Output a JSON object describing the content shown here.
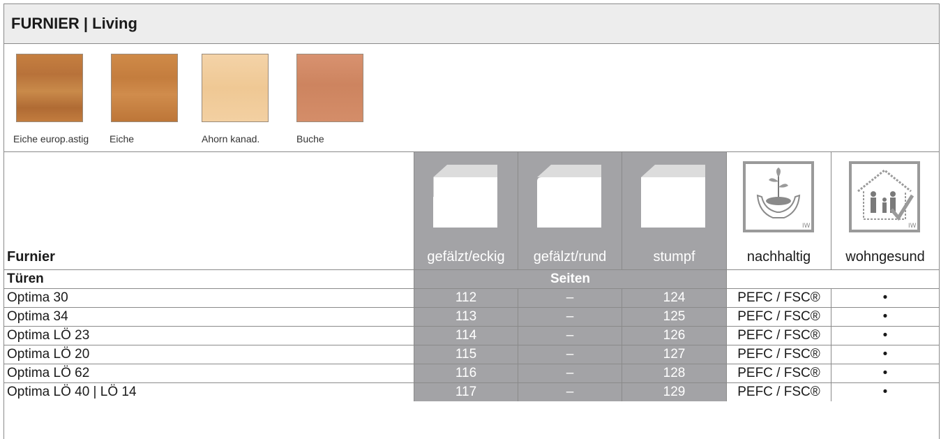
{
  "title": "FURNIER | Living",
  "swatches": [
    {
      "label": "Eiche europ.astig",
      "color": "#c07a3c"
    },
    {
      "label": "Eiche",
      "color": "#c98140"
    },
    {
      "label": "Ahorn kanad.",
      "color": "#f1cc9d"
    },
    {
      "label": "Buche",
      "color": "#d28a66"
    }
  ],
  "table": {
    "first_header": "Furnier",
    "columns": [
      "gefälzt/eckig",
      "gefälzt/rund",
      "stumpf",
      "nachhaltig",
      "wohngesund"
    ],
    "section_label": "Türen",
    "section_span_label": "Seiten",
    "rows": [
      {
        "name": "Optima 30",
        "a": "112",
        "b": "–",
        "c": "124",
        "d": "PEFC / FSC®",
        "e": "•"
      },
      {
        "name": "Optima 34",
        "a": "113",
        "b": "–",
        "c": "125",
        "d": "PEFC / FSC®",
        "e": "•"
      },
      {
        "name": "Optima LÖ 23",
        "a": "114",
        "b": "–",
        "c": "126",
        "d": "PEFC / FSC®",
        "e": "•"
      },
      {
        "name": "Optima LÖ 20",
        "a": "115",
        "b": "–",
        "c": "127",
        "d": "PEFC / FSC®",
        "e": "•"
      },
      {
        "name": "Optima LÖ 62",
        "a": "116",
        "b": "–",
        "c": "128",
        "d": "PEFC / FSC®",
        "e": "•"
      },
      {
        "name": "Optima LÖ 40 | LÖ 14",
        "a": "117",
        "b": "–",
        "c": "129",
        "d": "PEFC / FSC®",
        "e": "•"
      }
    ]
  }
}
